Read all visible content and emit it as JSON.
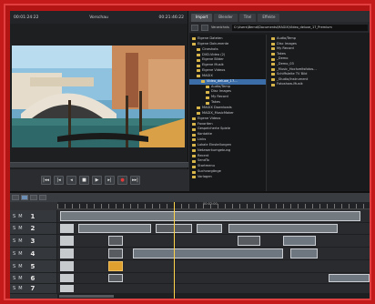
{
  "preview": {
    "timecode_left": "00:01:24:22",
    "label": "Vorschau",
    "timecode_right": "00:21:46:22"
  },
  "browser": {
    "tabs": [
      "Import",
      "Blender",
      "Titel",
      "Effekte"
    ],
    "nav_label": "Verzeichnis",
    "path": "C:\\Users\\Bernd\\Documents\\MAGIX\\Video_deluxe_17_Premium",
    "tree": [
      "Eigene Dateien",
      "Eigene Dokumente",
      "Cineshots",
      "DVD-Video (2)",
      "Eigene Bilder",
      "Eigene Musik",
      "Eigene Videos",
      "MAGIX",
      "Video_deluxe_17...",
      "Audio/Temp",
      "Disc Images",
      "My Record",
      "Takes",
      "MAGIX Downloads",
      "MAGIX_MusicMaker",
      "Eigene Videos",
      "Favoriten",
      "Gespeicherte Spiele",
      "Kontakte",
      "Links",
      "Lokale Einstellungen",
      "Netzwerkumgebung",
      "Recent",
      "SendTo",
      "Startmenu",
      "Suchvorgänge",
      "Vorlagen"
    ],
    "files": [
      "Audio/Temp",
      "Disc Images",
      "My Record",
      "Takes",
      "_Demo",
      "_Demo_03",
      "_Music_Hochzeitsfotos...",
      "Schiffsleite TV Bild",
      "_Studio/Instrument",
      "Fotoshow-Musik"
    ]
  },
  "timeline": {
    "ruler_time": "00:02:00",
    "tracks": [
      {
        "number": "1",
        "s": "S",
        "m": "M"
      },
      {
        "number": "2",
        "s": "S",
        "m": "M"
      },
      {
        "number": "3",
        "s": "S",
        "m": "M"
      },
      {
        "number": "4",
        "s": "S",
        "m": "M"
      },
      {
        "number": "5",
        "s": "S",
        "m": "M"
      },
      {
        "number": "6",
        "s": "S",
        "m": "M"
      },
      {
        "number": "7",
        "s": "S",
        "m": "M"
      }
    ]
  },
  "transport": {
    "buttons": [
      "|◂◂",
      "|◂",
      "◂",
      "■",
      "▶",
      "▸|",
      "●",
      "▸▸|"
    ]
  }
}
